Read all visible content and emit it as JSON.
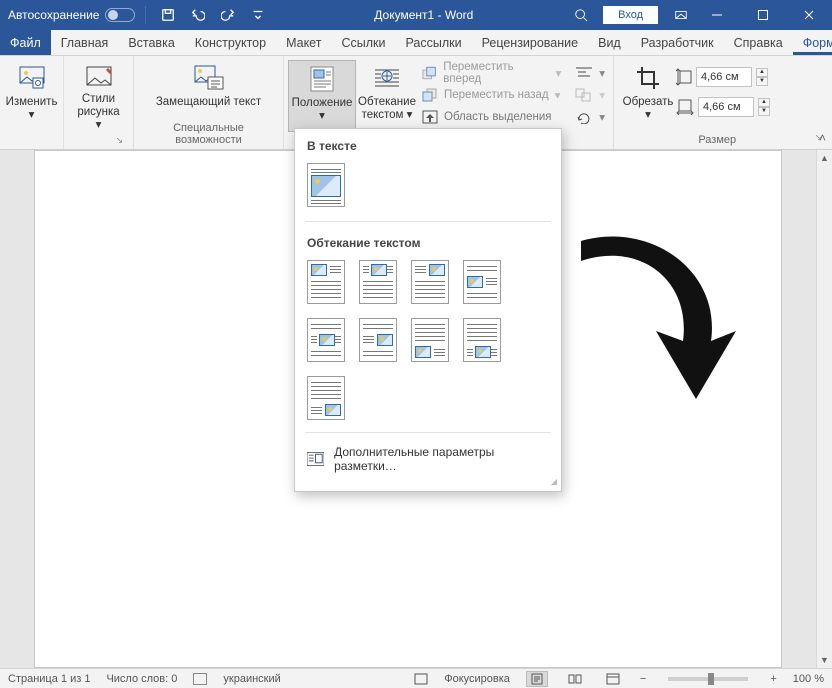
{
  "titlebar": {
    "autosave": "Автосохранение",
    "doc_title": "Документ1  -  Word",
    "login": "Вход"
  },
  "tabs": {
    "file": "Файл",
    "home": "Главная",
    "insert": "Вставка",
    "design": "Конструктор",
    "layout": "Макет",
    "references": "Ссылки",
    "mailings": "Рассылки",
    "review": "Рецензирование",
    "view": "Вид",
    "developer": "Разработчик",
    "help": "Справка",
    "format": "Формат граф"
  },
  "ribbon": {
    "adjust": "Изменить",
    "picstyles": "Стили рисунка",
    "alttext": "Замещающий текст",
    "accessibility_group": "Специальные возможности",
    "position": "Положение",
    "wrap": "Обтекание текстом",
    "bring_forward": "Переместить вперед",
    "send_backward": "Переместить назад",
    "selection_pane": "Область выделения",
    "crop": "Обрезать",
    "height_val": "4,66 см",
    "width_val": "4,66 см",
    "size_group": "Размер"
  },
  "dropdown": {
    "section_inline": "В тексте",
    "section_wrap": "Обтекание текстом",
    "more_options": "Дополнительные параметры разметки…"
  },
  "status": {
    "page": "Страница 1 из 1",
    "words": "Число слов: 0",
    "lang": "украинский",
    "focus": "Фокусировка",
    "zoom": "100 %"
  }
}
